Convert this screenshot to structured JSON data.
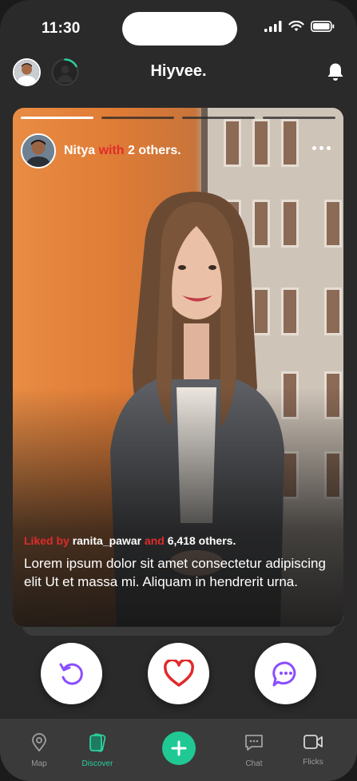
{
  "status_bar": {
    "time": "11:30"
  },
  "header": {
    "title": "Hiyvee."
  },
  "story": {
    "progress_total": 4,
    "progress_active_index": 0,
    "user": {
      "name": "Nitya",
      "with": "with",
      "others": "2 others."
    },
    "liked_by": {
      "prefix": "Liked by",
      "user": "ranita_pawar",
      "conj": "and",
      "count": "6,418 others."
    },
    "caption": "Lorem ipsum dolor sit amet consectetur adipiscing elit Ut et massa mi. Aliquam in hendrerit urna."
  },
  "actions": {
    "replay_icon": "replay-icon",
    "like_icon": "heart-icon",
    "comment_icon": "comment-icon",
    "accent_color": "#8a4dff",
    "like_color": "#e02b2b"
  },
  "nav": {
    "items": [
      {
        "label": "Map",
        "icon": "map-pin-icon"
      },
      {
        "label": "Discover",
        "icon": "discover-icon",
        "active": true
      },
      {
        "label": "Chat",
        "icon": "chat-icon"
      },
      {
        "label": "Flicks",
        "icon": "video-icon"
      }
    ],
    "fab_icon": "plus-icon",
    "active_color": "#2bd09e"
  }
}
